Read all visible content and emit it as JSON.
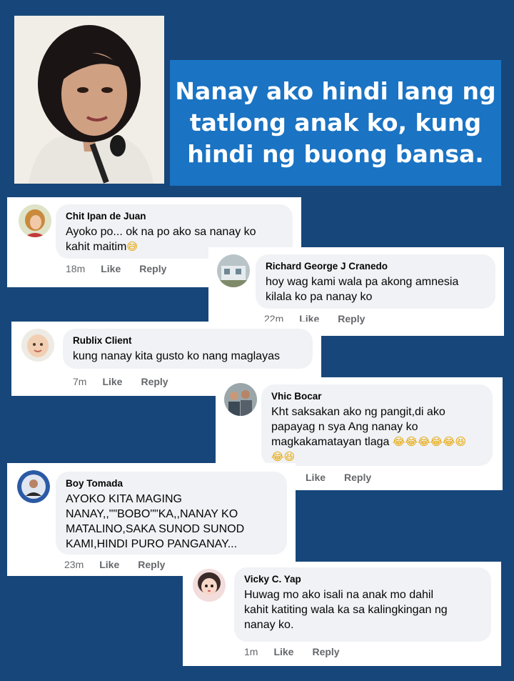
{
  "header": {
    "quote_lines": [
      "Nanay ako hindi lang ng",
      "tatlong anak ko, kung",
      "hindi ng buong bansa."
    ],
    "quote_bg": "#1a73c3"
  },
  "colors": {
    "background": "#17467a",
    "card": "#ffffff",
    "bubble": "#f0f2f5",
    "meta": "#65676b"
  },
  "comments": [
    {
      "author": "Chit Ipan de Juan",
      "text_lines": [
        "Ayoko po... ok na po ako sa nanay ko",
        "kahit maitim"
      ],
      "emoji": "😅",
      "time": "18m",
      "like": "Like",
      "reply": "Reply",
      "avatar_icon": "woman-portrait-icon"
    },
    {
      "author": "Richard George J Cranedo",
      "text_lines": [
        "hoy wag kami wala pa akong amnesia",
        "kilala ko pa nanay ko"
      ],
      "time": "22m",
      "like": "Like",
      "reply": "Reply",
      "avatar_icon": "building-photo-icon"
    },
    {
      "author": "Rublix Client",
      "text_lines": [
        "kung nanay kita gusto ko nang maglayas"
      ],
      "time": "7m",
      "like": "Like",
      "reply": "Reply",
      "avatar_icon": "baby-photo-icon"
    },
    {
      "author": "Vhic Bocar",
      "text_lines": [
        "Kht saksakan ako ng pangit,di ako",
        "papayag n sya Ang nanay ko",
        "magkakamatayan tlaga"
      ],
      "emoji_row1": "😂😂😂😂😂😆",
      "emoji_row2": "😂😆",
      "like": "Like",
      "reply": "Reply",
      "avatar_icon": "group-photo-icon"
    },
    {
      "author": "Boy Tomada",
      "text_lines": [
        "AYOKO KITA MAGING",
        "NANAY,,\"\"BOBO\"\"KA,,NANAY KO",
        "MATALINO,SAKA SUNOD SUNOD",
        "KAMI,HINDI PURO PANGANAY..."
      ],
      "time": "23m",
      "like": "Like",
      "reply": "Reply",
      "avatar_icon": "man-badge-photo-icon"
    },
    {
      "author": "Vicky C. Yap",
      "text_lines": [
        "Huwag mo ako isali na anak mo dahil",
        "kahit katiting wala ka sa kalingkingan ng",
        "nanay ko."
      ],
      "time": "1m",
      "like": "Like",
      "reply": "Reply",
      "avatar_icon": "doll-photo-icon"
    }
  ]
}
